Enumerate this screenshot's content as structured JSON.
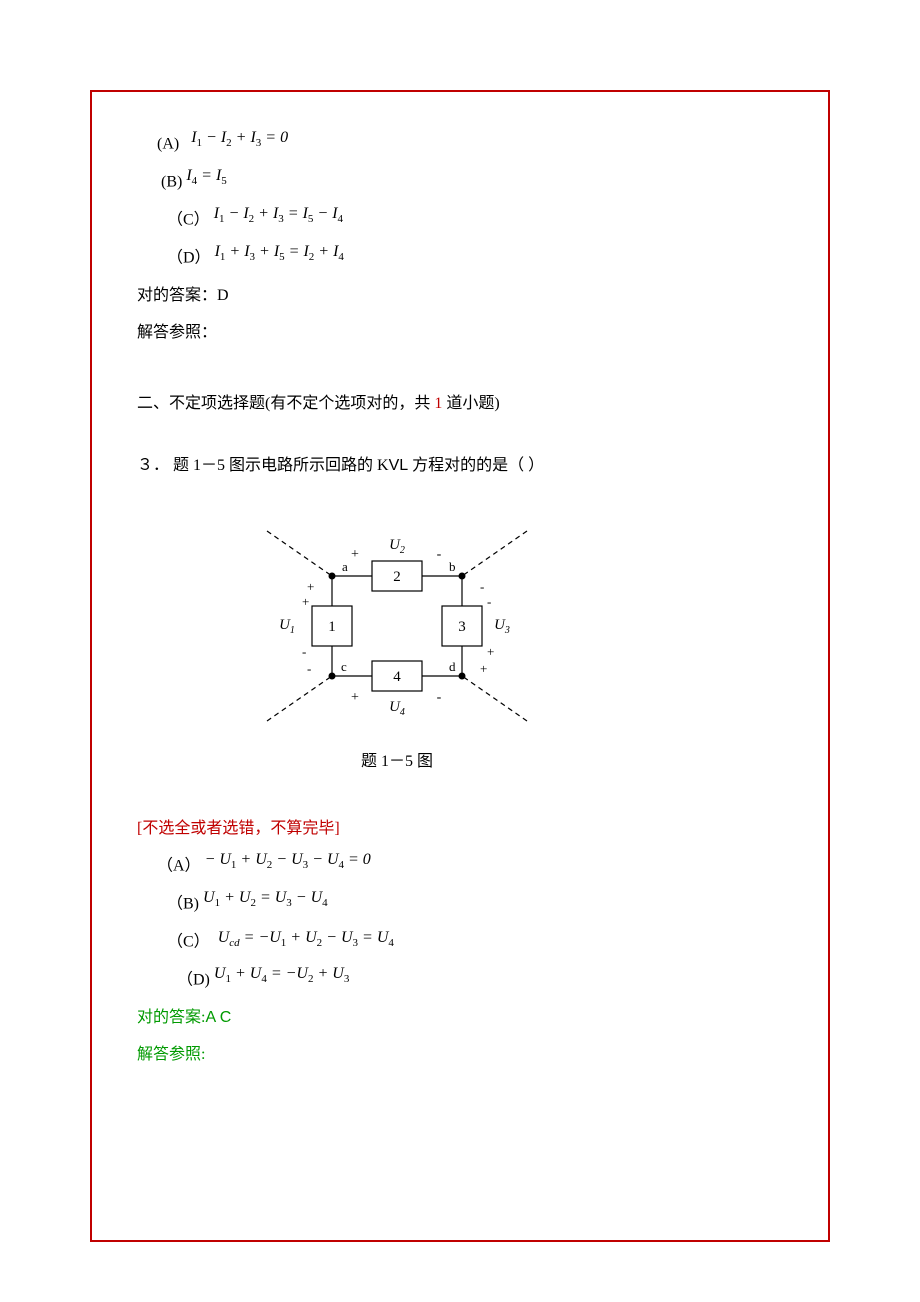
{
  "q2": {
    "optA_label": "(A)",
    "optA_math": "I₁ − I₂ + I₃ = 0",
    "optB_label": "(B)",
    "optB_math": "I₄ = I₅",
    "optC_label": "（C）",
    "optC_math": "I₁ − I₂ + I₃ = I₅ − I₄",
    "optD_label": "（D）",
    "optD_math": "I₁ + I₃ + I₅ = I₂ + I₄",
    "answer_label": "对的答案：D",
    "ref_label": "解答参照：",
    "answer": "D"
  },
  "section2": {
    "title_pre": "二、不定项选择题(有不定个选项对的，共 ",
    "count": "1",
    "title_post": " 道小题)"
  },
  "q3": {
    "stem_pre": "３．  题 1－5 图示电路所示回路的 K",
    "stem_vl": "VL",
    "stem_post": " 方程对的的是（             ）",
    "figure_labels": {
      "U1": "U₁",
      "U2": "U₂",
      "U3": "U₃",
      "U4": "U₄",
      "a": "a",
      "b": "b",
      "c": "c",
      "d": "d",
      "b1": "1",
      "b2": "2",
      "b3": "3",
      "b4": "4"
    },
    "caption": "题 1－5 图",
    "note": "[不选全或者选错，不算完毕]",
    "optA_label": "（A）",
    "optA_math": "− U₁ + U₂ − U₃ − U₄ = 0",
    "optB_label": "（B)",
    "optB_math": "U₁ + U₂ = U₃ − U₄",
    "optC_label": "（C）",
    "optC_math": "U_cd = −U₁ + U₂ − U₃ = U₄",
    "optD_label": "（D)",
    "optD_math": "U₁ + U₄ = −U₂ + U₃",
    "answer_label": "对的答案:",
    "answer": "A  C",
    "ref_label": "解答参照:"
  }
}
